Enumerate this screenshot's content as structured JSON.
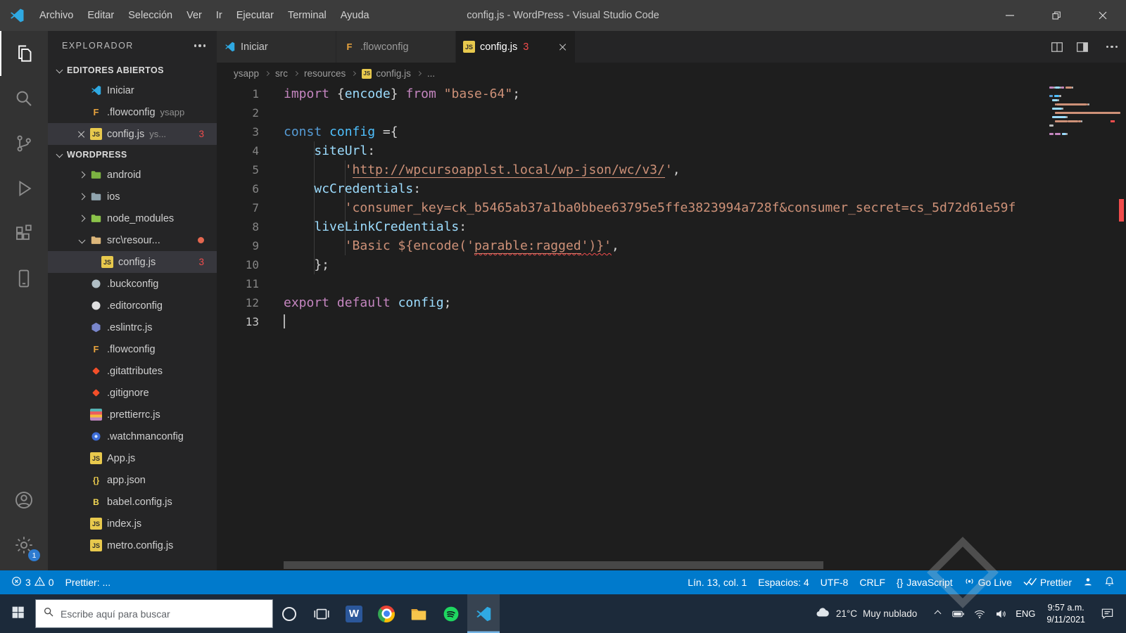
{
  "titlebar": {
    "menus": [
      "Archivo",
      "Editar",
      "Selección",
      "Ver",
      "Ir",
      "Ejecutar",
      "Terminal",
      "Ayuda"
    ],
    "title": "config.js - WordPress - Visual Studio Code"
  },
  "activity_bar": {
    "top": [
      {
        "name": "explorer",
        "active": true
      },
      {
        "name": "search"
      },
      {
        "name": "source-control"
      },
      {
        "name": "run-and-debug"
      },
      {
        "name": "extensions"
      },
      {
        "name": "mobile-view"
      }
    ],
    "bottom": [
      {
        "name": "accounts"
      },
      {
        "name": "settings",
        "badge": "1"
      }
    ]
  },
  "sidebar": {
    "title": "EXPLORADOR",
    "sections": [
      {
        "label": "EDITORES ABIERTOS",
        "rows": [
          {
            "icon": "vscode",
            "label": "Iniciar"
          },
          {
            "icon": "flow",
            "label": ".flowconfig",
            "detail": "ysapp"
          },
          {
            "icon": "js",
            "label": "config.js",
            "detail": "ys...",
            "badge": "3",
            "close": true,
            "highlight": true
          }
        ]
      },
      {
        "label": "WORDPRESS",
        "rows": [
          {
            "icon": "folder-android",
            "label": "android",
            "chevron": "collapsed"
          },
          {
            "icon": "folder-ios",
            "label": "ios",
            "chevron": "collapsed"
          },
          {
            "icon": "folder-node",
            "label": "node_modules",
            "chevron": "collapsed"
          },
          {
            "icon": "folder-src",
            "label": "src\\resour...",
            "chevron": "expanded",
            "dot": true
          },
          {
            "icon": "js",
            "label": "config.js",
            "badge": "3",
            "indent": 1,
            "selected": true
          },
          {
            "icon": "buck",
            "label": ".buckconfig"
          },
          {
            "icon": "editorconfig",
            "label": ".editorconfig"
          },
          {
            "icon": "eslint",
            "label": ".eslintrc.js"
          },
          {
            "icon": "flow",
            "label": ".flowconfig"
          },
          {
            "icon": "git",
            "label": ".gitattributes"
          },
          {
            "icon": "git",
            "label": ".gitignore"
          },
          {
            "icon": "prettier",
            "label": ".prettierrc.js"
          },
          {
            "icon": "watchman",
            "label": ".watchmanconfig"
          },
          {
            "icon": "js",
            "label": "App.js"
          },
          {
            "icon": "json",
            "label": "app.json"
          },
          {
            "icon": "babel",
            "label": "babel.config.js"
          },
          {
            "icon": "js",
            "label": "index.js"
          },
          {
            "icon": "js",
            "label": "metro.config.js"
          }
        ]
      }
    ]
  },
  "tabs": [
    {
      "icon": "vscode",
      "label": "Iniciar"
    },
    {
      "icon": "flow",
      "label": ".flowconfig"
    },
    {
      "icon": "js",
      "label": "config.js",
      "badge": "3",
      "active": true,
      "close": true
    }
  ],
  "breadcrumb": [
    {
      "label": "ysapp"
    },
    {
      "label": "src"
    },
    {
      "label": "resources"
    },
    {
      "label": "config.js",
      "icon": "js"
    },
    {
      "label": "..."
    }
  ],
  "editor": {
    "cursor_line": 13,
    "lines": [
      {
        "n": 1,
        "tokens": [
          {
            "t": "import",
            "c": "k"
          },
          {
            "t": " {",
            "c": "p"
          },
          {
            "t": "encode",
            "c": "v"
          },
          {
            "t": "} ",
            "c": "p"
          },
          {
            "t": "from",
            "c": "k"
          },
          {
            "t": " ",
            "c": "p"
          },
          {
            "t": "\"base-64\"",
            "c": "s"
          },
          {
            "t": ";",
            "c": "p"
          }
        ]
      },
      {
        "n": 2,
        "tokens": []
      },
      {
        "n": 3,
        "tokens": [
          {
            "t": "const",
            "c": "b"
          },
          {
            "t": " ",
            "c": "p"
          },
          {
            "t": "config",
            "c": "cn"
          },
          {
            "t": " ={",
            "c": "p"
          }
        ]
      },
      {
        "n": 4,
        "tokens": [
          {
            "t": "    ",
            "c": "p"
          },
          {
            "t": "siteUrl",
            "c": "v"
          },
          {
            "t": ":",
            "c": "p"
          }
        ]
      },
      {
        "n": 5,
        "tokens": [
          {
            "t": "        ",
            "c": "p"
          },
          {
            "t": "'",
            "c": "s"
          },
          {
            "t": "http://wpcursoapplst.local/wp-json/wc/v3/",
            "c": "s u"
          },
          {
            "t": "'",
            "c": "s"
          },
          {
            "t": ",",
            "c": "p"
          }
        ]
      },
      {
        "n": 6,
        "tokens": [
          {
            "t": "    ",
            "c": "p"
          },
          {
            "t": "wcCredentials",
            "c": "v"
          },
          {
            "t": ":",
            "c": "p"
          }
        ]
      },
      {
        "n": 7,
        "tokens": [
          {
            "t": "        ",
            "c": "p"
          },
          {
            "t": "'consumer_key=ck_b5465ab37a1ba0bbee63795e5ffe3823994a728f&consumer_secret=cs_5d72d61e59f",
            "c": "s"
          }
        ]
      },
      {
        "n": 8,
        "tokens": [
          {
            "t": "    ",
            "c": "p"
          },
          {
            "t": "liveLinkCredentials",
            "c": "v"
          },
          {
            "t": ":",
            "c": "p"
          }
        ]
      },
      {
        "n": 9,
        "tokens": [
          {
            "t": "        ",
            "c": "p"
          },
          {
            "t": "'Basic ${encode('",
            "c": "s"
          },
          {
            "t": "parable:ragged",
            "c": "s u e"
          },
          {
            "t": "')}'",
            "c": "s e"
          },
          {
            "t": ",",
            "c": "p"
          }
        ]
      },
      {
        "n": 10,
        "tokens": [
          {
            "t": "    };",
            "c": "p"
          }
        ]
      },
      {
        "n": 11,
        "tokens": []
      },
      {
        "n": 12,
        "tokens": [
          {
            "t": "export",
            "c": "k"
          },
          {
            "t": " ",
            "c": "p"
          },
          {
            "t": "default",
            "c": "k"
          },
          {
            "t": " ",
            "c": "p"
          },
          {
            "t": "config",
            "c": "v"
          },
          {
            "t": ";",
            "c": "p"
          }
        ]
      },
      {
        "n": 13,
        "tokens": []
      }
    ]
  },
  "status_bar": {
    "errors": "3",
    "warnings": "0",
    "prettier_status": "Prettier: ...",
    "line_col": "Lín. 13, col. 1",
    "indent": "Espacios: 4",
    "encoding": "UTF-8",
    "eol": "CRLF",
    "braces": "{}",
    "language": "JavaScript",
    "go_live": "Go Live",
    "prettier": "Prettier"
  },
  "taskbar": {
    "search_placeholder": "Escribe aquí para buscar",
    "apps": [
      {
        "name": "cortana"
      },
      {
        "name": "task-view"
      },
      {
        "name": "word"
      },
      {
        "name": "chrome"
      },
      {
        "name": "file-explorer"
      },
      {
        "name": "spotify"
      },
      {
        "name": "vscode",
        "active": true
      }
    ],
    "weather_temp": "21°C",
    "weather_desc": "Muy nublado",
    "language": "ENG",
    "time": "9:57 a.m.",
    "date": "9/11/2021"
  }
}
